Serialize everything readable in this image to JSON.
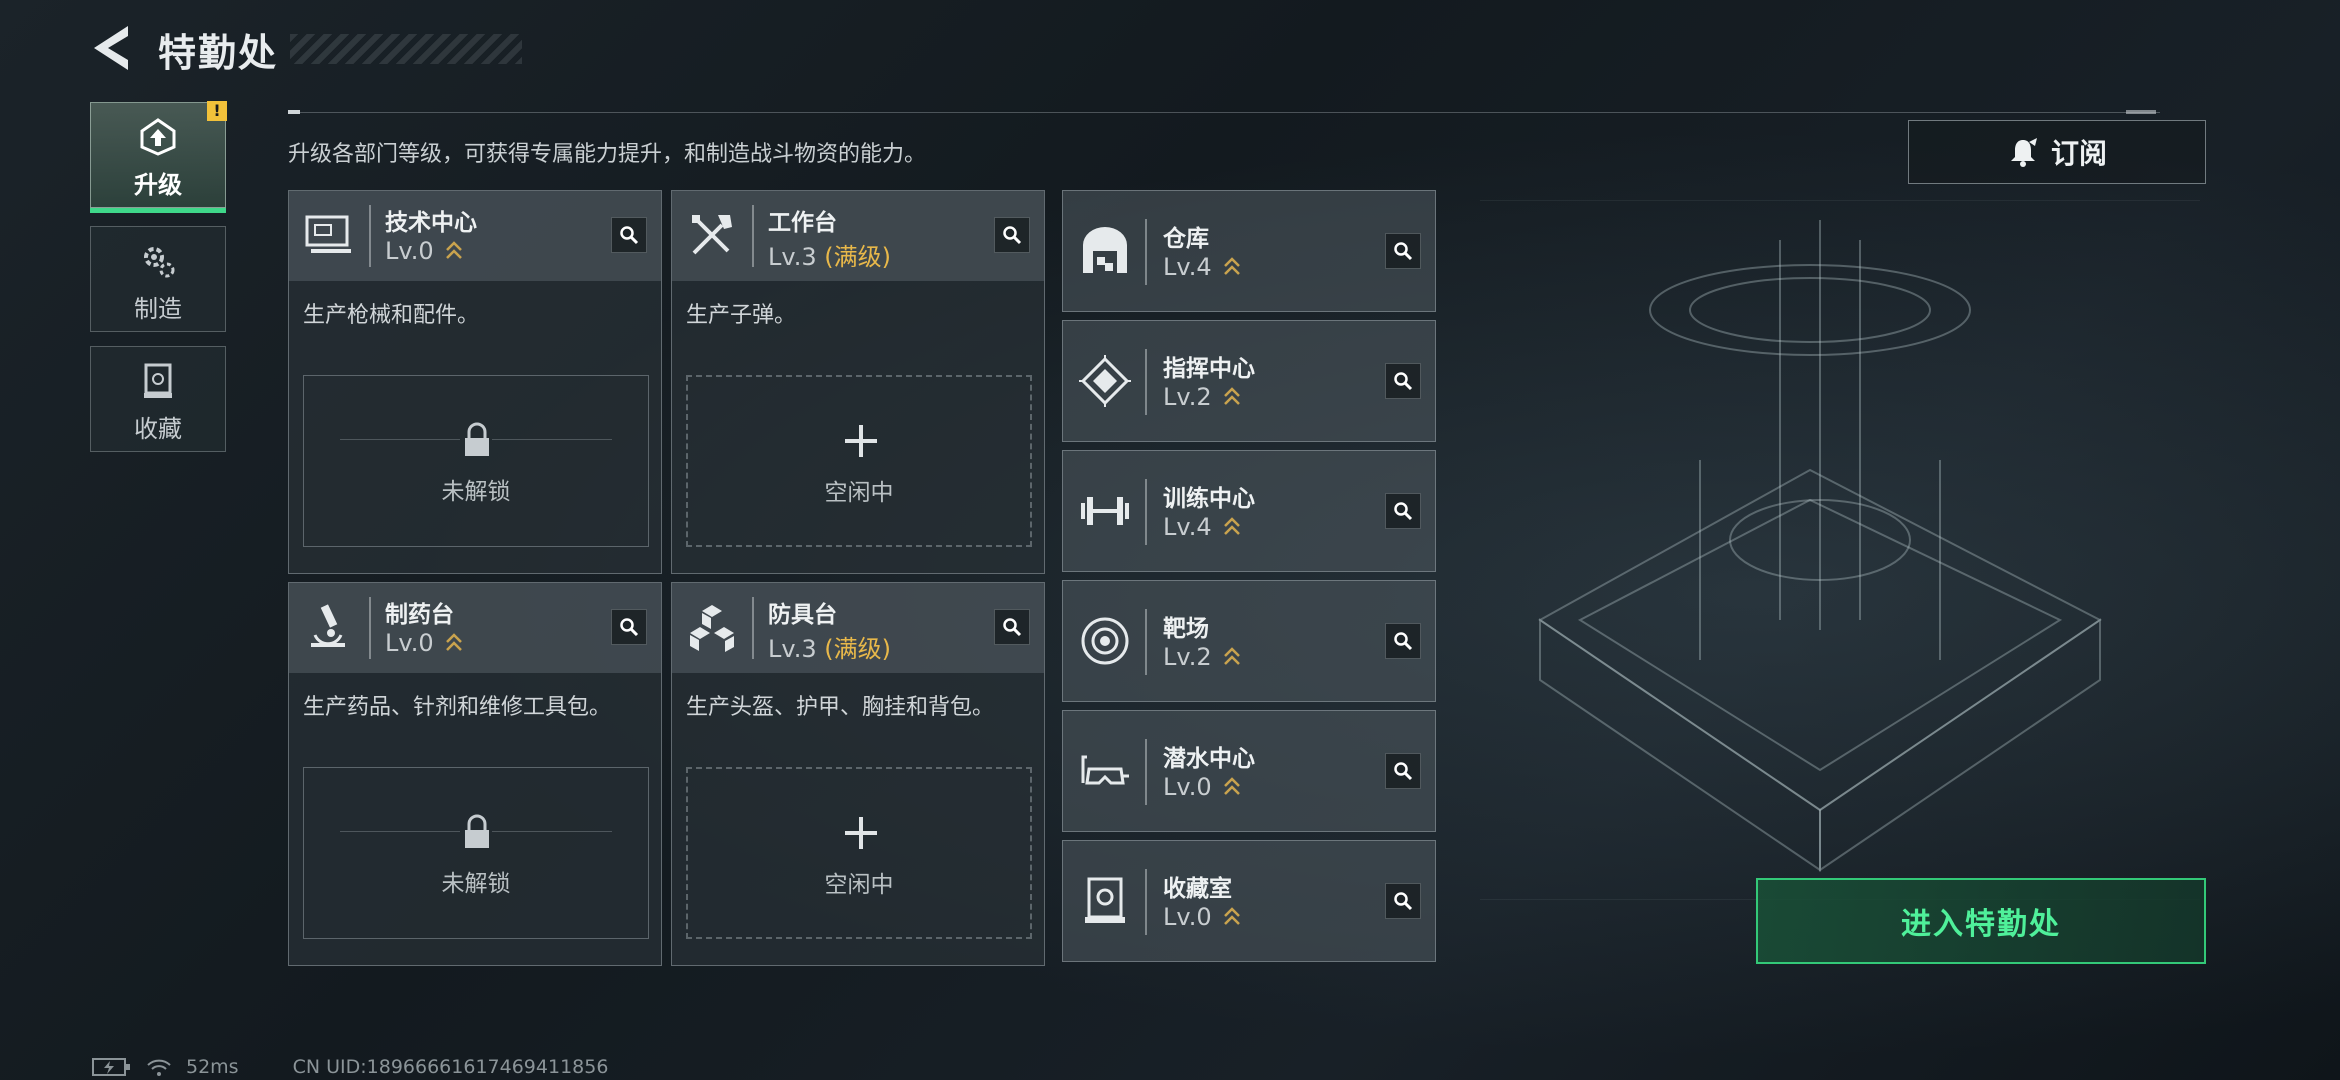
{
  "header": {
    "title": "特勤处"
  },
  "sidebar": {
    "tabs": [
      {
        "label": "升级",
        "active": true,
        "badge": "!"
      },
      {
        "label": "制造",
        "active": false
      },
      {
        "label": "收藏",
        "active": false
      }
    ]
  },
  "intro_text": "升级各部门等级，可获得专属能力提升，和制造战斗物资的能力。",
  "subscribe_label": "订阅",
  "departments_main": [
    {
      "name": "技术中心",
      "level": "Lv.0",
      "max_tag": "",
      "desc": "生产枪械和配件。",
      "slot_state": "未解锁",
      "slot_type": "locked",
      "icon": "computer-icon"
    },
    {
      "name": "工作台",
      "level": "Lv.3",
      "max_tag": "(满级)",
      "desc": "生产子弹。",
      "slot_state": "空闲中",
      "slot_type": "idle",
      "icon": "tools-icon"
    },
    {
      "name": "制药台",
      "level": "Lv.0",
      "max_tag": "",
      "desc": "生产药品、针剂和维修工具包。",
      "slot_state": "未解锁",
      "slot_type": "locked",
      "icon": "microscope-icon"
    },
    {
      "name": "防具台",
      "level": "Lv.3",
      "max_tag": "(满级)",
      "desc": "生产头盔、护甲、胸挂和背包。",
      "slot_state": "空闲中",
      "slot_type": "idle",
      "icon": "cubes-icon"
    }
  ],
  "departments_side": [
    {
      "name": "仓库",
      "level": "Lv.4",
      "icon": "warehouse-icon"
    },
    {
      "name": "指挥中心",
      "level": "Lv.2",
      "icon": "chip-icon"
    },
    {
      "name": "训练中心",
      "level": "Lv.4",
      "icon": "dumbbell-icon"
    },
    {
      "name": "靶场",
      "level": "Lv.2",
      "icon": "target-icon"
    },
    {
      "name": "潜水中心",
      "level": "Lv.0",
      "icon": "diving-mask-icon"
    },
    {
      "name": "收藏室",
      "level": "Lv.0",
      "icon": "display-case-icon"
    }
  ],
  "enter_button": "进入特勤处",
  "status": {
    "ping": "52ms",
    "uid": "CN UID:18966661617469411856"
  },
  "colors": {
    "accent_green": "#3fd88a",
    "max_gold": "#e8b84a",
    "alert_yellow": "#f2c13a"
  }
}
